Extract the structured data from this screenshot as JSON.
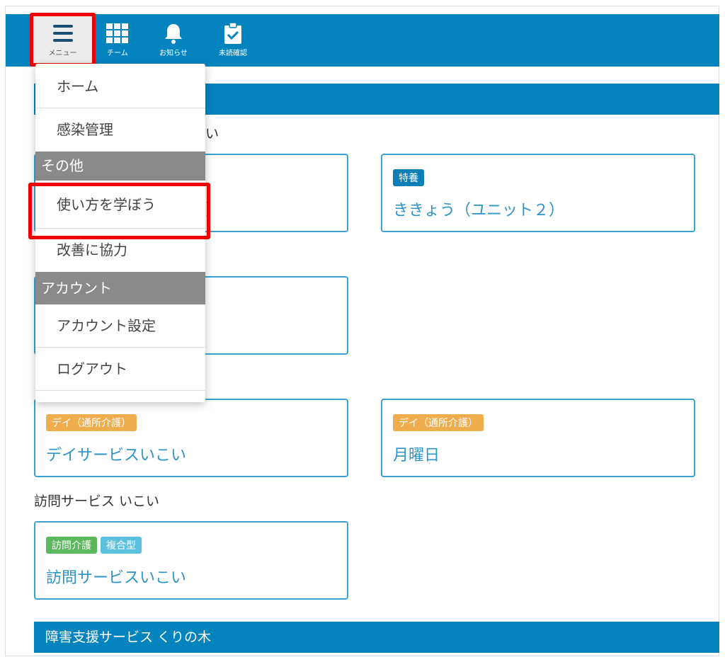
{
  "nav": [
    {
      "label": "メニュー",
      "icon": "hamburger-icon"
    },
    {
      "label": "チーム",
      "icon": "grid-icon"
    },
    {
      "label": "お知らせ",
      "icon": "bell-icon"
    },
    {
      "label": "未読確認",
      "icon": "clipboard-check-icon"
    }
  ],
  "menu": {
    "items": [
      "ホーム",
      "感染管理"
    ],
    "header_other": "その他",
    "other_items": [
      "使い方を学ぼう",
      "改善に協力"
    ],
    "header_account": "アカウント",
    "account_items": [
      "アカウント設定",
      "ログアウト"
    ]
  },
  "fragments": {
    "label_tail": "い",
    "card_tail": "）"
  },
  "cards": [
    {
      "badges": [
        "特養"
      ],
      "name": "ききょう（ユニット２）"
    },
    {
      "badges": [
        "デイ（通所介護）"
      ],
      "name": "デイサービスいこい"
    },
    {
      "badges": [
        "デイ（通所介護）"
      ],
      "name": "月曜日"
    },
    {
      "badges": [
        "訪問介護",
        "複合型"
      ],
      "name": "訪問サービスいこい"
    }
  ],
  "section_label_visit": "訪問サービス いこい",
  "section_bottom": "障害支援サービス くりの木",
  "colors": {
    "primary": "#0384bf",
    "tokuyo": "#0a7fb8",
    "day": "#f0ad4e",
    "visit": "#5cb85c",
    "complex": "#5bc0de",
    "highlight": "#e00000"
  }
}
